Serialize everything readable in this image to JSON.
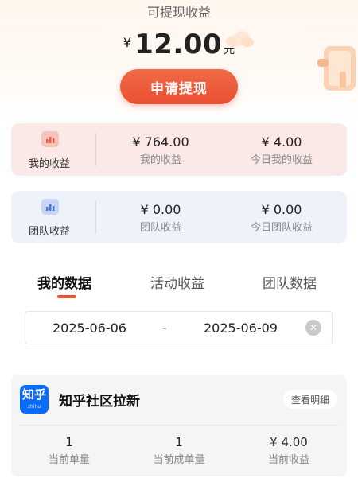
{
  "withdraw": {
    "title": "可提现收益",
    "currency": "¥",
    "amount": "12.00",
    "unit": "元",
    "button_label": "申请提现"
  },
  "my_income": {
    "label": "我的收益",
    "stats": [
      {
        "value": "¥ 764.00",
        "label": "我的收益"
      },
      {
        "value": "¥ 4.00",
        "label": "今日我的收益"
      }
    ]
  },
  "team_income": {
    "label": "团队收益",
    "stats": [
      {
        "value": "¥ 0.00",
        "label": "团队收益"
      },
      {
        "value": "¥ 0.00",
        "label": "今日团队收益"
      }
    ]
  },
  "tabs": [
    {
      "label": "我的数据",
      "active": true
    },
    {
      "label": "活动收益",
      "active": false
    },
    {
      "label": "团队数据",
      "active": false
    }
  ],
  "date_range": {
    "start": "2025-06-06",
    "separator": "-",
    "end": "2025-06-09"
  },
  "task": {
    "logo_text": "知乎",
    "logo_sub": "zhihu",
    "title": "知乎社区拉新",
    "detail_label": "查看明细",
    "stats": [
      {
        "value": "1",
        "label": "当前单量"
      },
      {
        "value": "1",
        "label": "当前成单量"
      },
      {
        "value": "¥ 4.00",
        "label": "当前收益"
      }
    ]
  },
  "colors": {
    "accent": "#ea4f33",
    "my_card_bg": "#fbe9e7",
    "team_card_bg": "#eef3fb",
    "zhihu_blue": "#0a6cff"
  }
}
